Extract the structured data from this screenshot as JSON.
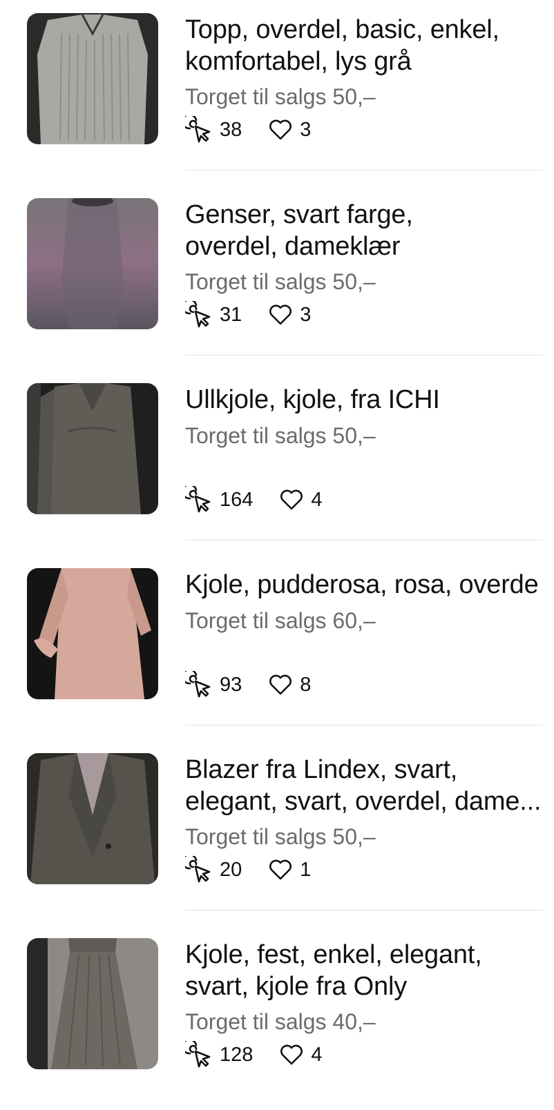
{
  "listings": [
    {
      "title_lines": [
        "Topp, overdel, basic, enkel,",
        "komfortabel, lys grå"
      ],
      "price": "Torget til salgs 50,–",
      "clicks": "38",
      "likes": "3",
      "thumb_color": "#a9a8a3"
    },
    {
      "title_lines": [
        "Genser, svart farge,",
        "overdel, dameklær"
      ],
      "price": "Torget til salgs 50,–",
      "clicks": "31",
      "likes": "3",
      "thumb_color": "#6f6670"
    },
    {
      "title_lines": [
        "Ullkjole, kjole, fra ICHI"
      ],
      "price": "Torget til salgs 50,–",
      "clicks": "164",
      "likes": "4",
      "thumb_color": "#5f5d56"
    },
    {
      "title_lines": [
        "Kjole, pudderosa, rosa, overde"
      ],
      "price": "Torget til salgs 60,–",
      "clicks": "93",
      "likes": "8",
      "thumb_color": "#d4a99b"
    },
    {
      "title_lines": [
        "Blazer fra Lindex, svart,",
        "elegant, svart, overdel, dame..."
      ],
      "price": "Torget til salgs 50,–",
      "clicks": "20",
      "likes": "1",
      "thumb_color": "#4b4943"
    },
    {
      "title_lines": [
        "Kjole, fest, enkel, elegant,",
        "svart, kjole fra Only"
      ],
      "price": "Torget til salgs 40,–",
      "clicks": "128",
      "likes": "4",
      "thumb_color": "#6c6862"
    }
  ],
  "icons": {
    "clicks": "cursor-click-icon",
    "likes": "heart-icon"
  }
}
